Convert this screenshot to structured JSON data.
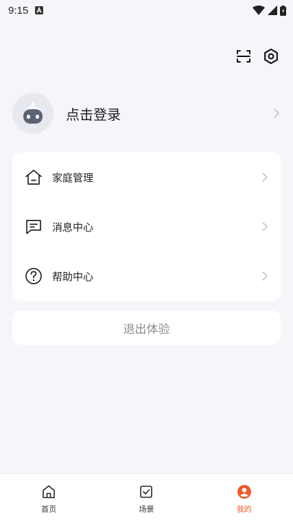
{
  "status_bar": {
    "time": "9:15"
  },
  "profile": {
    "login_label": "点击登录"
  },
  "menu": {
    "items": [
      {
        "label": "家庭管理",
        "icon": "home-icon"
      },
      {
        "label": "消息中心",
        "icon": "message-icon"
      },
      {
        "label": "帮助中心",
        "icon": "help-icon"
      }
    ]
  },
  "logout_label": "退出体验",
  "tabbar": {
    "tabs": [
      {
        "label": "首页",
        "icon": "home-tab-icon",
        "active": false
      },
      {
        "label": "场景",
        "icon": "scene-tab-icon",
        "active": false
      },
      {
        "label": "我的",
        "icon": "profile-tab-icon",
        "active": true
      }
    ]
  },
  "colors": {
    "accent": "#f15a2b",
    "background": "#f5f6fa",
    "card": "#ffffff",
    "muted_text": "#8e8e93"
  }
}
